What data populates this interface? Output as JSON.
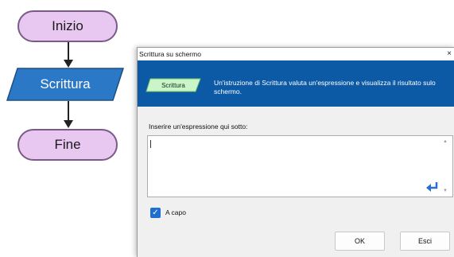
{
  "flowchart": {
    "start_label": "Inizio",
    "output_label": "Scrittura",
    "end_label": "Fine",
    "colors": {
      "terminal_fill": "#e8c8f0",
      "terminal_border": "#7a5a88",
      "output_fill": "#2a78c6"
    }
  },
  "dialog": {
    "title": "Scrittura su schermo",
    "close_glyph": "×",
    "banner": {
      "shape_label": "Scrittura",
      "description": "Un'istruzione di Scrittura valuta un'espressione e visualizza il risultato sulo schermo.",
      "color": "#0c5aa6"
    },
    "prompt_label": "Inserire un'espressione qui sotto:",
    "expression_value": "",
    "checkbox": {
      "label": "A capo",
      "checked": true
    },
    "buttons": {
      "ok": "OK",
      "cancel": "Esci"
    }
  }
}
